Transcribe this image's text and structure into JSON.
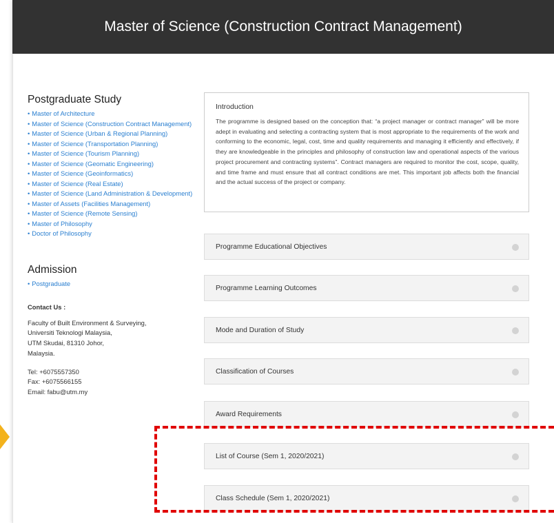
{
  "header": {
    "title": "Master of Science (Construction Contract Management)"
  },
  "sidebar": {
    "postgraduate_heading": "Postgraduate Study",
    "programmes": [
      "Master of Architecture",
      "Master of Science (Construction Contract Management)",
      "Master of Science (Urban & Regional Planning)",
      "Master of Science (Transportation Planning)",
      "Master of Science (Tourism Planning)",
      "Master of Science (Geomatic Engineering)",
      "Master of Science (Geoinformatics)",
      "Master of Science (Real Estate)",
      "Master of Science (Land Administration & Development)",
      "Master of Assets (Facilities Management)",
      "Master of Science (Remote Sensing)",
      "Master of Philosophy",
      "Doctor of Philosophy"
    ],
    "admission_heading": "Admission",
    "admission_items": [
      "Postgraduate"
    ],
    "contact": {
      "title": "Contact Us :",
      "address": [
        "Faculty of Built Environment & Surveying,",
        "Universiti Teknologi Malaysia,",
        "UTM Skudai, 81310 Johor,",
        "Malaysia."
      ],
      "tel": "Tel: +6075557350",
      "fax": "Fax: +6075566155",
      "email": "Email: fabu@utm.my"
    }
  },
  "intro": {
    "title": "Introduction",
    "text": "The programme is designed based on the conception that: “a project manager or contract manager” will be more adept in evaluating and selecting a contracting system that is most appropriate to the requirements of the work and conforming to the economic, legal, cost, time and quality requirements and managing it efficiently and effectively, if they are knowledgeable in the principles and philosophy of construction law and operational aspects of the various project procurement and contracting systems”. Contract managers are required to monitor the cost, scope, quality, and time frame and must ensure that all contract conditions are met. This important job affects both the financial and the actual success of the project or company."
  },
  "accordion": [
    "Programme Educational Objectives",
    "Programme Learning Outcomes",
    "Mode and Duration of Study",
    "Classification of Courses",
    "Award Requirements",
    "List of Course (Sem 1, 2020/2021)",
    "Class Schedule (Sem 1, 2020/2021)"
  ],
  "colors": {
    "header_bg": "#323232",
    "link": "#2a7fd0",
    "highlight": "#e00000"
  }
}
